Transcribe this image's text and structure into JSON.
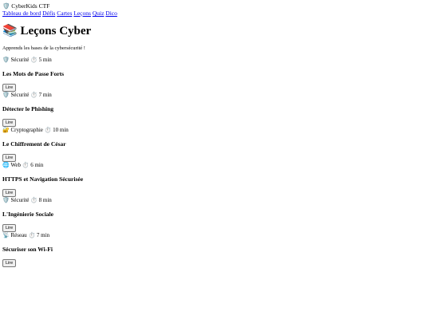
{
  "app": {
    "logo_icon": "🛡️",
    "name": "CyberKids CTF"
  },
  "nav": {
    "items": [
      {
        "label": "Tableau de bord"
      },
      {
        "label": "Défis"
      },
      {
        "label": "Cartes"
      },
      {
        "label": "Leçons"
      },
      {
        "label": "Quiz"
      },
      {
        "label": "Dico"
      }
    ]
  },
  "page": {
    "title_icon": "📚",
    "title": "Leçons Cyber",
    "subtitle": "Apprends les bases de la cybersécurité !"
  },
  "time_icon": "⏱️",
  "lessons": [
    {
      "category_icon": "🛡️",
      "category": "Sécurité",
      "duration": "5 min",
      "title": "Les Mots de Passe Forts",
      "button": "Lire"
    },
    {
      "category_icon": "🛡️",
      "category": "Sécurité",
      "duration": "7 min",
      "title": "Détecter le Phishing",
      "button": "Lire"
    },
    {
      "category_icon": "🔐",
      "category": "Cryptographie",
      "duration": "10 min",
      "title": "Le Chiffrement de César",
      "button": "Lire"
    },
    {
      "category_icon": "🌐",
      "category": "Web",
      "duration": "6 min",
      "title": "HTTPS et Navigation Sécurisée",
      "button": "Lire"
    },
    {
      "category_icon": "🛡️",
      "category": "Sécurité",
      "duration": "8 min",
      "title": "L'Ingénierie Sociale",
      "button": "Lire"
    },
    {
      "category_icon": "📡",
      "category": "Réseau",
      "duration": "7 min",
      "title": "Sécuriser son Wi-Fi",
      "button": "Lire"
    }
  ]
}
